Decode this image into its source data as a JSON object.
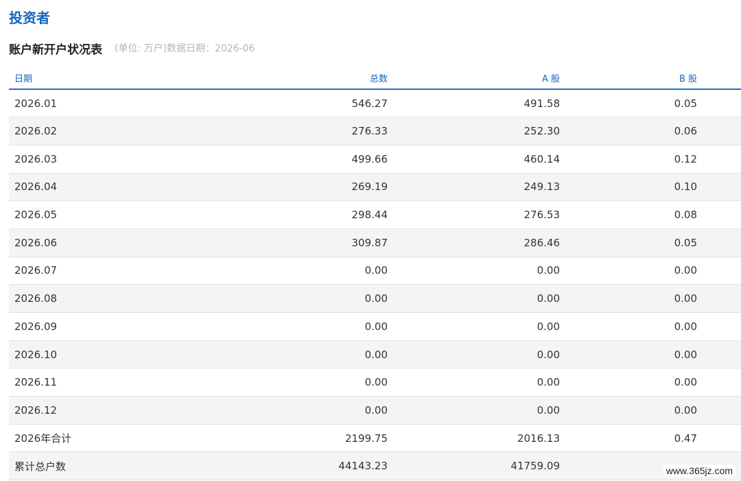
{
  "section_title": "投资者",
  "table": {
    "title": "账户新开户状况表",
    "meta": "(单位: 万户)数据日期：2026-06",
    "headers": {
      "date": "日期",
      "total": "总数",
      "a_share": "A 股",
      "b_share": "B 股"
    },
    "rows": [
      {
        "date": "2026.01",
        "total": "546.27",
        "a_share": "491.58",
        "b_share": "0.05"
      },
      {
        "date": "2026.02",
        "total": "276.33",
        "a_share": "252.30",
        "b_share": "0.06"
      },
      {
        "date": "2026.03",
        "total": "499.66",
        "a_share": "460.14",
        "b_share": "0.12"
      },
      {
        "date": "2026.04",
        "total": "269.19",
        "a_share": "249.13",
        "b_share": "0.10"
      },
      {
        "date": "2026.05",
        "total": "298.44",
        "a_share": "276.53",
        "b_share": "0.08"
      },
      {
        "date": "2026.06",
        "total": "309.87",
        "a_share": "286.46",
        "b_share": "0.05"
      },
      {
        "date": "2026.07",
        "total": "0.00",
        "a_share": "0.00",
        "b_share": "0.00"
      },
      {
        "date": "2026.08",
        "total": "0.00",
        "a_share": "0.00",
        "b_share": "0.00"
      },
      {
        "date": "2026.09",
        "total": "0.00",
        "a_share": "0.00",
        "b_share": "0.00"
      },
      {
        "date": "2026.10",
        "total": "0.00",
        "a_share": "0.00",
        "b_share": "0.00"
      },
      {
        "date": "2026.11",
        "total": "0.00",
        "a_share": "0.00",
        "b_share": "0.00"
      },
      {
        "date": "2026.12",
        "total": "0.00",
        "a_share": "0.00",
        "b_share": "0.00"
      },
      {
        "date": "2026年合计",
        "total": "2199.75",
        "a_share": "2016.13",
        "b_share": "0.47"
      },
      {
        "date": "累计总户数",
        "total": "44143.23",
        "a_share": "41759.09",
        "b_share": ""
      }
    ]
  },
  "watermark": "www.365jz.com",
  "colors": {
    "accent": "#1565c0",
    "header_rule": "#1e6fd0",
    "alt_row": "#f4f4f4",
    "muted_text": "#b5b5b5"
  }
}
